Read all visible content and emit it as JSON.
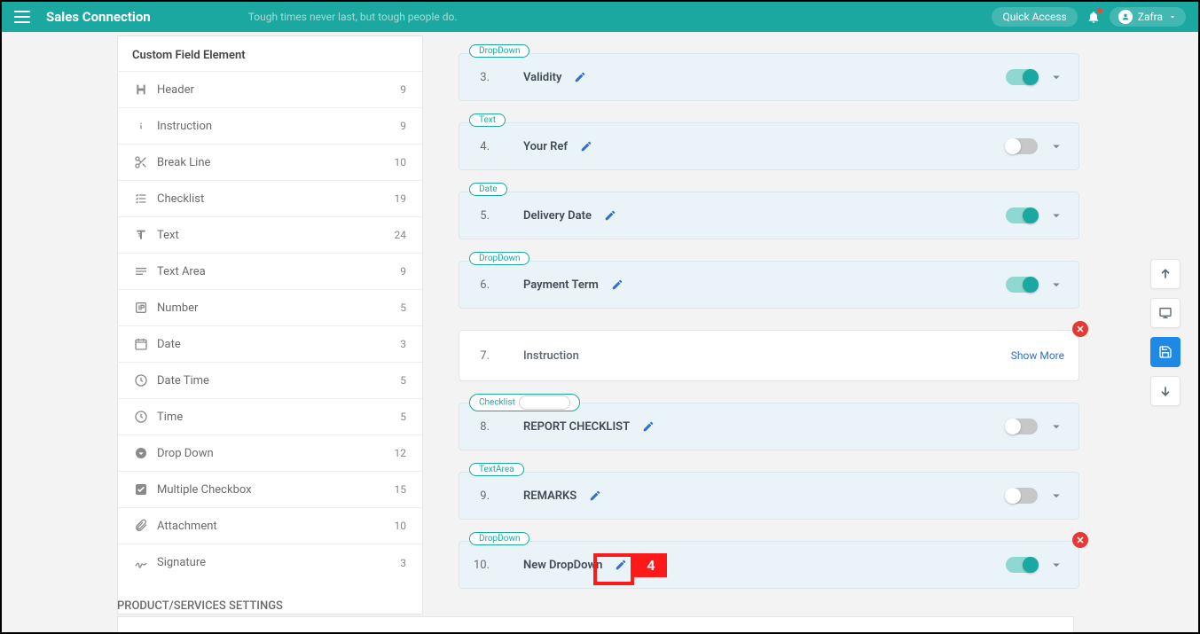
{
  "topbar": {
    "brand": "Sales Connection",
    "tagline": "Tough times never last, but tough people do.",
    "quick_access": "Quick Access",
    "user_name": "Zafra"
  },
  "left_panel": {
    "title": "Custom Field Element",
    "elements": [
      {
        "icon": "header",
        "label": "Header",
        "count": "9"
      },
      {
        "icon": "info",
        "label": "Instruction",
        "count": "9"
      },
      {
        "icon": "scissors",
        "label": "Break Line",
        "count": "10"
      },
      {
        "icon": "checklist",
        "label": "Checklist",
        "count": "19"
      },
      {
        "icon": "text",
        "label": "Text",
        "count": "24"
      },
      {
        "icon": "textarea",
        "label": "Text Area",
        "count": "9"
      },
      {
        "icon": "number",
        "label": "Number",
        "count": "5"
      },
      {
        "icon": "date",
        "label": "Date",
        "count": "3"
      },
      {
        "icon": "clock",
        "label": "Date Time",
        "count": "5"
      },
      {
        "icon": "clock",
        "label": "Time",
        "count": "5"
      },
      {
        "icon": "dropdown",
        "label": "Drop Down",
        "count": "12"
      },
      {
        "icon": "checkbox",
        "label": "Multiple Checkbox",
        "count": "15"
      },
      {
        "icon": "attachment",
        "label": "Attachment",
        "count": "10"
      },
      {
        "icon": "signature",
        "label": "Signature",
        "count": "3"
      }
    ]
  },
  "fields": [
    {
      "num": "3.",
      "tag": "DropDown",
      "name": "Validity",
      "toggle": "on",
      "editable": true
    },
    {
      "num": "4.",
      "tag": "Text",
      "name": "Your Ref",
      "toggle": "off",
      "editable": true
    },
    {
      "num": "5.",
      "tag": "Date",
      "name": "Delivery Date",
      "toggle": "on",
      "editable": true
    },
    {
      "num": "6.",
      "tag": "DropDown",
      "name": "Payment Term",
      "toggle": "on",
      "editable": true
    },
    {
      "num": "7.",
      "tag": "",
      "name": "Instruction",
      "plain": true,
      "show_more": "Show More",
      "remove": true
    },
    {
      "num": "8.",
      "tag": "Checklist",
      "tag_extra": true,
      "name": "REPORT CHECKLIST",
      "toggle": "off",
      "editable": true
    },
    {
      "num": "9.",
      "tag": "TextArea",
      "name": "REMARKS",
      "toggle": "off",
      "editable": true
    },
    {
      "num": "10.",
      "tag": "DropDown",
      "name": "New DropDown",
      "toggle": "on",
      "editable": true,
      "remove": true,
      "callout": "4"
    }
  ],
  "section_heading": "PRODUCT/SERVICES SETTINGS"
}
